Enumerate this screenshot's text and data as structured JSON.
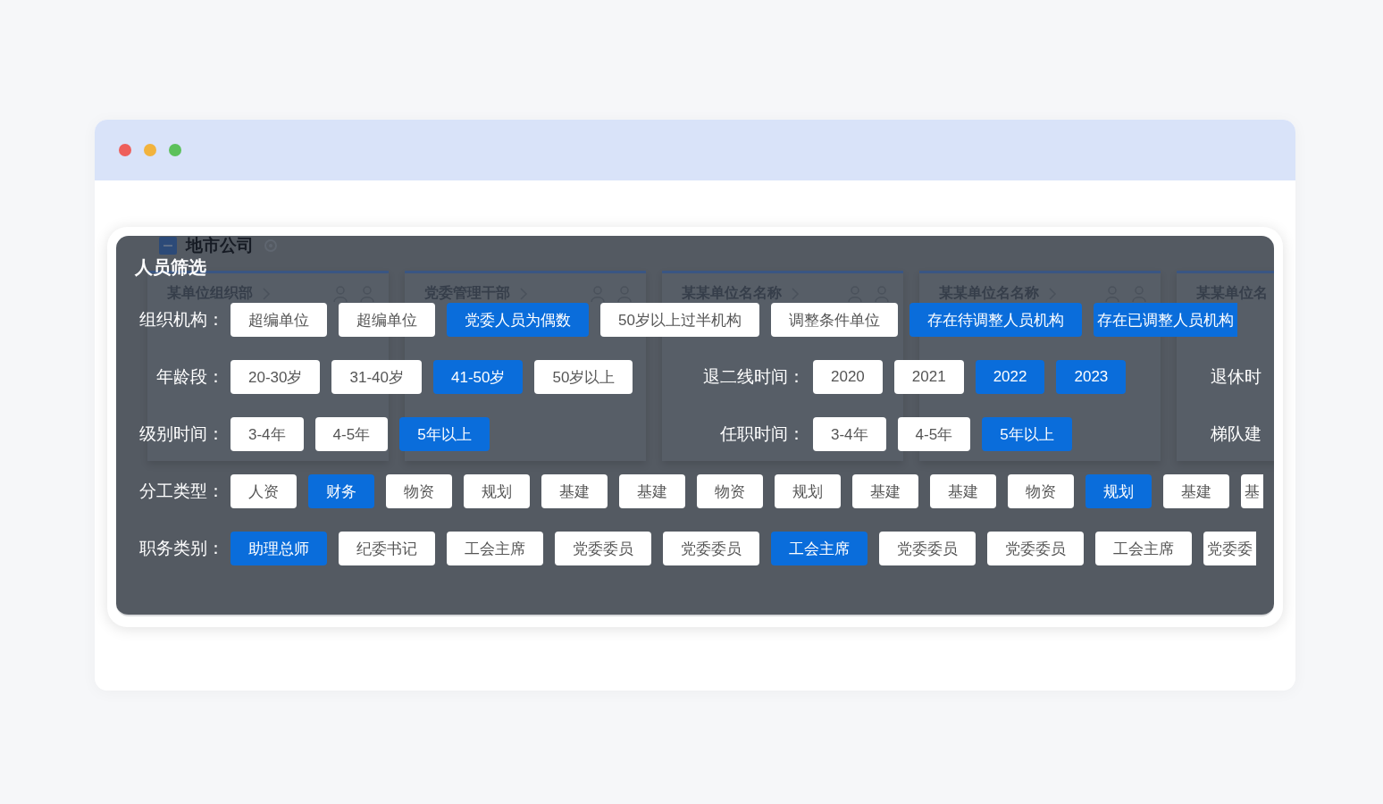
{
  "window": {
    "dots": [
      {
        "color": "#ee5f5b"
      },
      {
        "color": "#f2b33d"
      },
      {
        "color": "#5cc15b"
      }
    ]
  },
  "background": {
    "section_title": "地市公司",
    "cards": [
      {
        "title": "某单位组织部"
      },
      {
        "title": "党委管理干部"
      },
      {
        "title": "某某单位名名称"
      },
      {
        "title": "某某单位名名称"
      },
      {
        "title": "某某单位名"
      }
    ]
  },
  "filter": {
    "title": "人员筛选",
    "rows": [
      {
        "groups": [
          {
            "label": "组织机构：",
            "options": [
              {
                "label": "超编单位",
                "selected": false
              },
              {
                "label": "超编单位",
                "selected": false
              },
              {
                "label": "党委人员为偶数",
                "selected": true
              },
              {
                "label": "50岁以上过半机构",
                "selected": false
              },
              {
                "label": "调整条件单位",
                "selected": false
              },
              {
                "label": "存在待调整人员机构",
                "selected": true
              },
              {
                "label": "存在已调整人员机构",
                "selected": true
              }
            ]
          }
        ]
      },
      {
        "groups": [
          {
            "label": "年龄段：",
            "options": [
              {
                "label": "20-30岁",
                "selected": false
              },
              {
                "label": "31-40岁",
                "selected": false
              },
              {
                "label": "41-50岁",
                "selected": true
              },
              {
                "label": "50岁以上",
                "selected": false
              }
            ]
          },
          {
            "label": "退二线时间：",
            "options": [
              {
                "label": "2020",
                "selected": false
              },
              {
                "label": "2021",
                "selected": false
              },
              {
                "label": "2022",
                "selected": true
              },
              {
                "label": "2023",
                "selected": true
              }
            ]
          },
          {
            "label": "退休时"
          }
        ]
      },
      {
        "groups": [
          {
            "label": "级别时间：",
            "options": [
              {
                "label": "3-4年",
                "selected": false
              },
              {
                "label": "4-5年",
                "selected": false
              },
              {
                "label": "5年以上",
                "selected": true
              }
            ]
          },
          {
            "label": "任职时间：",
            "options": [
              {
                "label": "3-4年",
                "selected": false
              },
              {
                "label": "4-5年",
                "selected": false
              },
              {
                "label": "5年以上",
                "selected": true
              }
            ]
          },
          {
            "label": "梯队建"
          }
        ]
      },
      {
        "groups": [
          {
            "label": "分工类型：",
            "options": [
              {
                "label": "人资",
                "selected": false
              },
              {
                "label": "财务",
                "selected": true
              },
              {
                "label": "物资",
                "selected": false
              },
              {
                "label": "规划",
                "selected": false
              },
              {
                "label": "基建",
                "selected": false
              },
              {
                "label": "基建",
                "selected": false
              },
              {
                "label": "物资",
                "selected": false
              },
              {
                "label": "规划",
                "selected": false
              },
              {
                "label": "基建",
                "selected": false
              },
              {
                "label": "基建",
                "selected": false
              },
              {
                "label": "物资",
                "selected": false
              },
              {
                "label": "规划",
                "selected": true
              },
              {
                "label": "基建",
                "selected": false
              },
              {
                "label": "基",
                "selected": false
              }
            ]
          }
        ]
      },
      {
        "groups": [
          {
            "label": "职务类别：",
            "options": [
              {
                "label": "助理总师",
                "selected": true
              },
              {
                "label": "纪委书记",
                "selected": false
              },
              {
                "label": "工会主席",
                "selected": false
              },
              {
                "label": "党委委员",
                "selected": false
              },
              {
                "label": "党委委员",
                "selected": false
              },
              {
                "label": "工会主席",
                "selected": true
              },
              {
                "label": "党委委员",
                "selected": false
              },
              {
                "label": "党委委员",
                "selected": false
              },
              {
                "label": "工会主席",
                "selected": false
              },
              {
                "label": "党委委",
                "selected": false
              }
            ]
          }
        ]
      }
    ]
  }
}
